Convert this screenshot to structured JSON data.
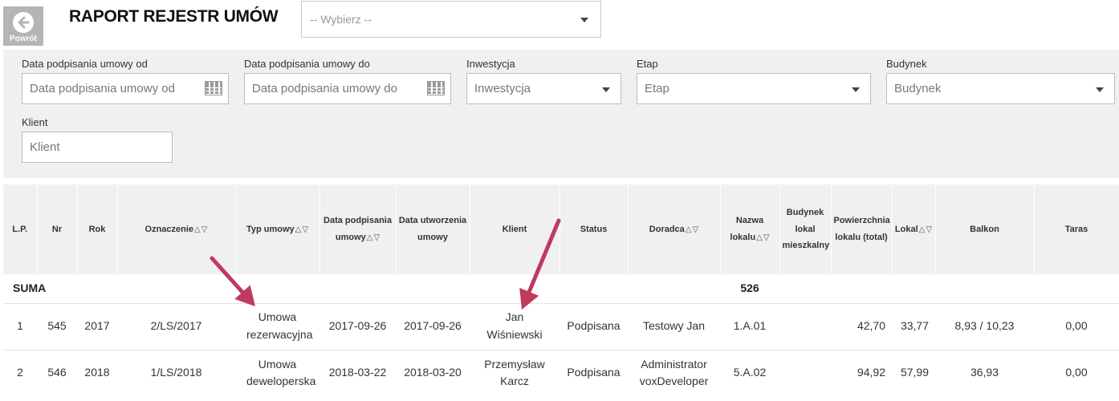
{
  "header": {
    "back_label": "Powrót",
    "title": "RAPORT REJESTR UMÓW",
    "report_select": {
      "value": "-- Wybierz --"
    }
  },
  "filters": {
    "date_from": {
      "label": "Data podpisania umowy od",
      "placeholder": "Data podpisania umowy od"
    },
    "date_to": {
      "label": "Data podpisania umowy do",
      "placeholder": "Data podpisania umowy do"
    },
    "investment": {
      "label": "Inwestycja",
      "placeholder": "Inwestycja"
    },
    "stage": {
      "label": "Etap",
      "placeholder": "Etap"
    },
    "building": {
      "label": "Budynek",
      "placeholder": "Budynek"
    },
    "client": {
      "label": "Klient",
      "placeholder": "Klient"
    }
  },
  "table": {
    "columns": [
      {
        "label": "L.P.",
        "sortable": false
      },
      {
        "label": "Nr",
        "sortable": false
      },
      {
        "label": "Rok",
        "sortable": false
      },
      {
        "label": "Oznaczenie",
        "sortable": true
      },
      {
        "label": "Typ umowy",
        "sortable": true
      },
      {
        "label": "Data podpisania umowy",
        "sortable": true
      },
      {
        "label": "Data utworzenia umowy",
        "sortable": false
      },
      {
        "label": "Klient",
        "sortable": false
      },
      {
        "label": "Status",
        "sortable": false
      },
      {
        "label": "Doradca",
        "sortable": true
      },
      {
        "label": "Nazwa lokalu",
        "sortable": true
      },
      {
        "label": "Budynek lokal mieszkalny",
        "sortable": false
      },
      {
        "label": "Powierzchnia lokalu (total)",
        "sortable": false
      },
      {
        "label": "Lokal",
        "sortable": true
      },
      {
        "label": "Balkon",
        "sortable": false
      },
      {
        "label": "Taras",
        "sortable": false
      }
    ],
    "summary": {
      "label": "SUMA",
      "nazwa_lokalu_total": "526"
    },
    "rows": [
      {
        "lp": "1",
        "nr": "545",
        "rok": "2017",
        "oznaczenie": "2/LS/2017",
        "typ_umowy": "Umowa rezerwacyjna",
        "data_podpisania": "2017-09-26",
        "data_utworzenia": "2017-09-26",
        "klient": "Jan Wiśniewski",
        "status": "Podpisana",
        "doradca": "Testowy Jan",
        "nazwa_lokalu": "1.A.01",
        "budynek": "",
        "powierzchnia": "42,70",
        "lokal": "33,77",
        "balkon": "8,93 / 10,23",
        "taras": "0,00"
      },
      {
        "lp": "2",
        "nr": "546",
        "rok": "2018",
        "oznaczenie": "1/LS/2018",
        "typ_umowy": "Umowa deweloperska",
        "data_podpisania": "2018-03-22",
        "data_utworzenia": "2018-03-20",
        "klient": "Przemysław Karcz",
        "status": "Podpisana",
        "doradca": "Administrator voxDeveloper",
        "nazwa_lokalu": "5.A.02",
        "budynek": "",
        "powierzchnia": "94,92",
        "lokal": "57,99",
        "balkon": "36,93",
        "taras": "0,00"
      }
    ]
  },
  "annotations": {
    "arrow_color": "#c0395f"
  }
}
